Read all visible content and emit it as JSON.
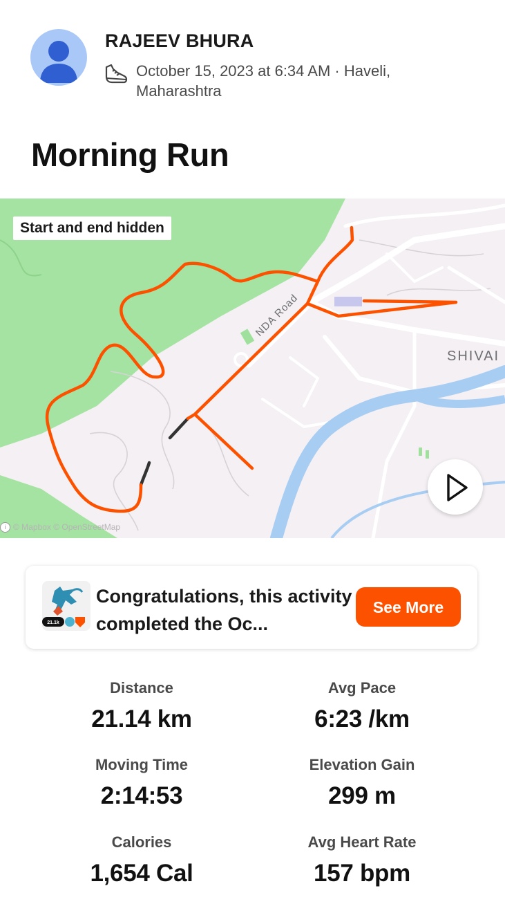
{
  "header": {
    "athlete_name": "RAJEEV BHURA",
    "meta_line": "October 15, 2023 at 6:34 AM · Haveli, Maharashtra",
    "activity_type_icon": "running-shoe-icon",
    "title": "Morning Run"
  },
  "map": {
    "privacy_label": "Start and end hidden",
    "place_label": "SHIVAI",
    "road_label": "NDA Road",
    "attribution": "© Mapbox © OpenStreetMap",
    "route_color": "#fc5200",
    "hidden_segment_color": "#333333",
    "park_color": "#9fe19c",
    "water_color": "#a8cdf3",
    "play_icon": "play-icon"
  },
  "challenge_card": {
    "badge_icon": "challenge-badge-icon",
    "badge_text": "21.1k",
    "text": "Congratulations, this activity completed the Oc...",
    "button_label": "See More",
    "button_color": "#fc5200"
  },
  "stats": [
    {
      "label": "Distance",
      "value": "21.14 km"
    },
    {
      "label": "Avg Pace",
      "value": "6:23 /km"
    },
    {
      "label": "Moving Time",
      "value": "2:14:53"
    },
    {
      "label": "Elevation Gain",
      "value": "299 m"
    },
    {
      "label": "Calories",
      "value": "1,654 Cal"
    },
    {
      "label": "Avg Heart Rate",
      "value": "157 bpm"
    }
  ]
}
